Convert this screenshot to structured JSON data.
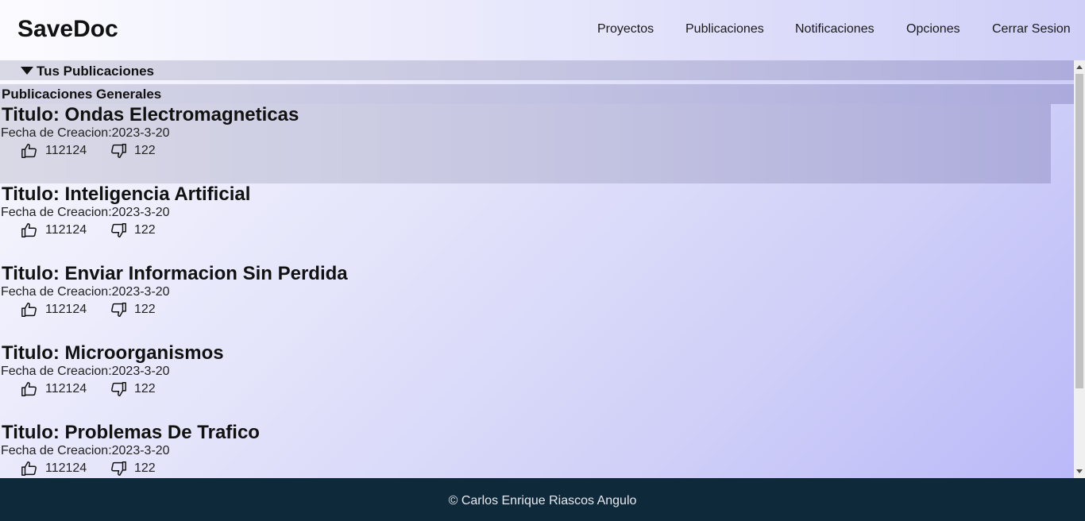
{
  "header": {
    "logo": "SaveDoc",
    "nav": [
      "Proyectos",
      "Publicaciones",
      "Notificaciones",
      "Opciones",
      "Cerrar Sesion"
    ]
  },
  "sections": {
    "own": "Tus Publicaciones",
    "general": "Publicaciones Generales"
  },
  "publications": [
    {
      "title": "Titulo: Ondas Electromagneticas",
      "date": "Fecha de Creacion:2023-3-20",
      "likes": "112124",
      "dislikes": "122"
    },
    {
      "title": "Titulo: Inteligencia Artificial",
      "date": "Fecha de Creacion:2023-3-20",
      "likes": "112124",
      "dislikes": "122"
    },
    {
      "title": "Titulo: Enviar Informacion Sin Perdida",
      "date": "Fecha de Creacion:2023-3-20",
      "likes": "112124",
      "dislikes": "122"
    },
    {
      "title": "Titulo: Microorganismos",
      "date": "Fecha de Creacion:2023-3-20",
      "likes": "112124",
      "dislikes": "122"
    },
    {
      "title": "Titulo: Problemas De Trafico",
      "date": "Fecha de Creacion:2023-3-20",
      "likes": "112124",
      "dislikes": "122"
    }
  ],
  "icons": {
    "like": "thumbs-up-icon",
    "dislike": "thumbs-down-icon"
  },
  "footer": {
    "text": "© Carlos Enrique Riascos Angulo"
  },
  "colors": {
    "footer_bg": "#0e2a3a",
    "accent": "#b8b6f8"
  }
}
